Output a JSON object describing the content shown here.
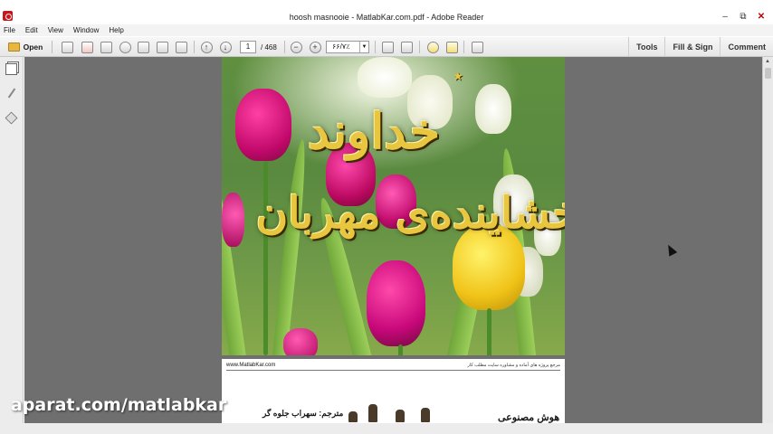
{
  "window": {
    "title": "hoosh masnooie - MatlabKar.com.pdf - Adobe Reader",
    "controls": {
      "minimize": "–",
      "restore": "⧉",
      "close": "✕"
    }
  },
  "menu": [
    "File",
    "Edit",
    "View",
    "Window",
    "Help"
  ],
  "toolbar": {
    "open_label": "Open",
    "page_current": "1",
    "page_total": "/ 468",
    "zoom_value": "۶۶/۷٪",
    "tabs": [
      "Tools",
      "Fill & Sign",
      "Comment"
    ]
  },
  "left_panel": {
    "icons": [
      "page-thumbnails-icon",
      "signature-icon",
      "layers-icon"
    ]
  },
  "page1": {
    "line1": "خداوند",
    "line2": "بخشاینده‌ی مهربان"
  },
  "page2": {
    "url": "www.MatlabKar.com",
    "header_right": "مرجع پروژه های آماده و مشاوره سایت مطلب کار",
    "translator": "مترجم: سهراب جلوه گر",
    "title": "هوش مصنوعی"
  },
  "watermark": "aparat.com/matlabkar",
  "colors": {
    "accent_red": "#c8141b",
    "calligraphy_gold": "#e8c640",
    "doc_background": "#6f6f6f"
  }
}
